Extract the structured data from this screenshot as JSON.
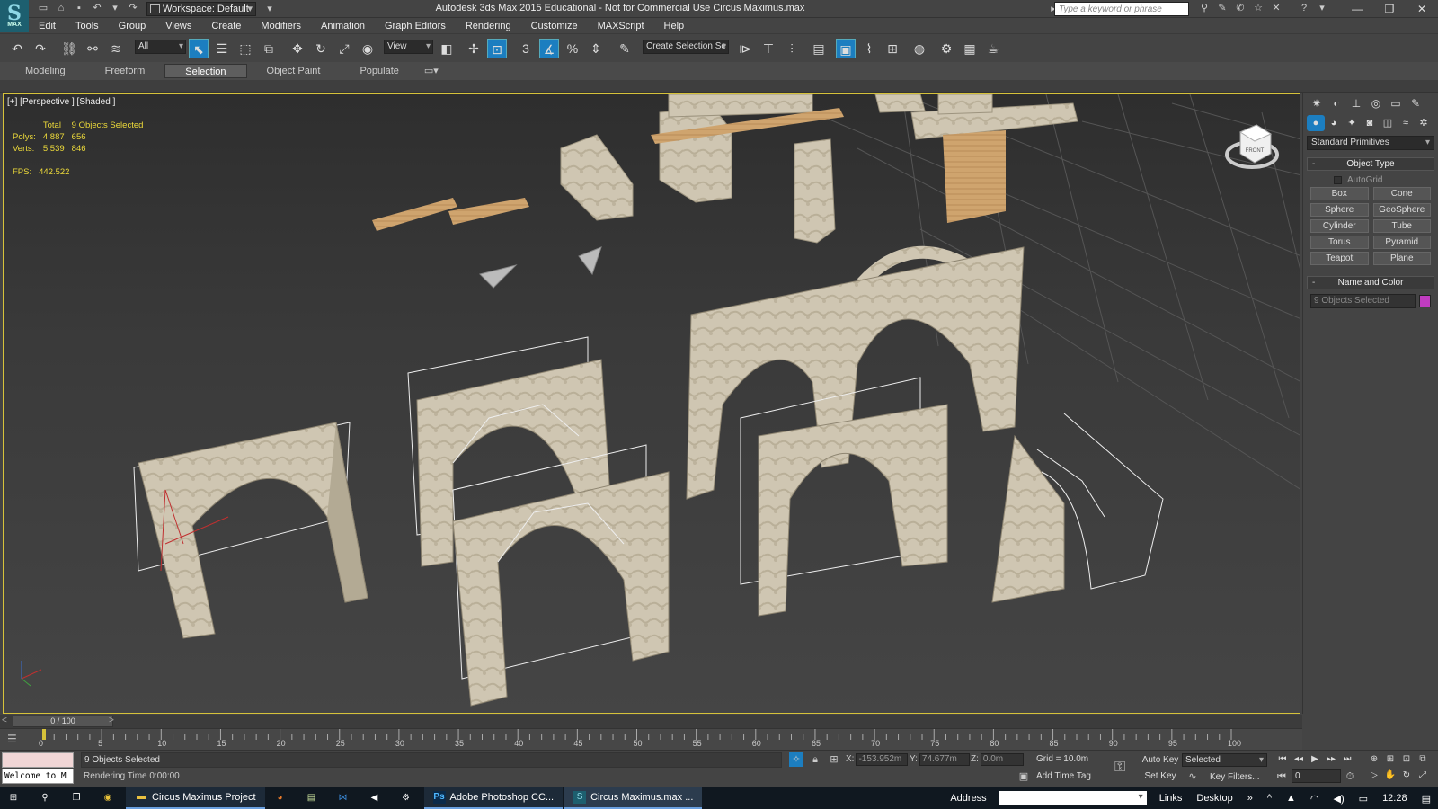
{
  "app": {
    "title": "Autodesk 3ds Max  2015  Educational - Not for Commercial Use   Circus Maximus.max",
    "workspace": "Workspace: Default",
    "search_placeholder": "Type a keyword or phrase",
    "logo_label": "MAX"
  },
  "menu": [
    "Edit",
    "Tools",
    "Group",
    "Views",
    "Create",
    "Modifiers",
    "Animation",
    "Graph Editors",
    "Rendering",
    "Customize",
    "MAXScript",
    "Help"
  ],
  "toolbar": {
    "filter_select": "All",
    "ref_coord_select": "View",
    "named_selection_placeholder": "Create Selection Se",
    "snap_label": "3",
    "angle_snap_label": "%"
  },
  "ribbon": {
    "tabs": [
      {
        "label": "Modeling",
        "active": false
      },
      {
        "label": "Freeform",
        "active": false
      },
      {
        "label": "Selection",
        "active": true
      },
      {
        "label": "Object Paint",
        "active": false
      },
      {
        "label": "Populate",
        "active": false
      }
    ]
  },
  "viewport": {
    "label": "[+] [Perspective ] [Shaded ]",
    "stats": {
      "header_total": "Total",
      "header_selected": "9 Objects Selected",
      "rows": [
        {
          "label": "Polys:",
          "total": "4,887",
          "selected": "656"
        },
        {
          "label": "Verts:",
          "total": "5,539",
          "selected": "846"
        }
      ],
      "fps_label": "FPS:",
      "fps_value": "442.522"
    },
    "viewcube_label": "FRONT"
  },
  "command_panel": {
    "primitive_type": "Standard Primitives",
    "object_type": {
      "title": "Object Type",
      "autogrid": "AutoGrid",
      "buttons": [
        "Box",
        "Cone",
        "Sphere",
        "GeoSphere",
        "Cylinder",
        "Tube",
        "Torus",
        "Pyramid",
        "Teapot",
        "Plane"
      ]
    },
    "name_and_color": {
      "title": "Name and Color",
      "name_value": "9 Objects Selected",
      "color": "#c03cc0"
    }
  },
  "timeline": {
    "slider_text": "0 / 100",
    "prev": "<",
    "next": ">",
    "tick_labels": [
      "0",
      "5",
      "10",
      "15",
      "20",
      "25",
      "30",
      "35",
      "40",
      "45",
      "50",
      "55",
      "60",
      "65",
      "70",
      "75",
      "80",
      "85",
      "90",
      "95",
      "100"
    ]
  },
  "statusbar": {
    "listener_text": "Welcome to M",
    "selection": "9 Objects Selected",
    "rendering_time": "Rendering Time  0:00:00",
    "x_label": "X:",
    "x_value": "-153.952m",
    "y_label": "Y:",
    "y_value": "74.677m",
    "z_label": "Z:",
    "z_value": "0.0m",
    "grid": "Grid = 10.0m",
    "add_time_tag": "Add Time Tag",
    "auto_key": "Auto Key",
    "set_key": "Set Key",
    "key_mode": "Selected",
    "key_filters": "Key Filters...",
    "frame": "0"
  },
  "taskbar": {
    "items": [
      "Circus Maximus Project",
      "Adobe Photoshop CC...",
      "Circus Maximus.max ..."
    ],
    "address_label": "Address",
    "links": "Links",
    "desktop": "Desktop",
    "clock": "12:28"
  },
  "colors": {
    "accent": "#1c7ec0",
    "viewport_border": "#d6c23a",
    "stats_text": "#eedb3a"
  }
}
